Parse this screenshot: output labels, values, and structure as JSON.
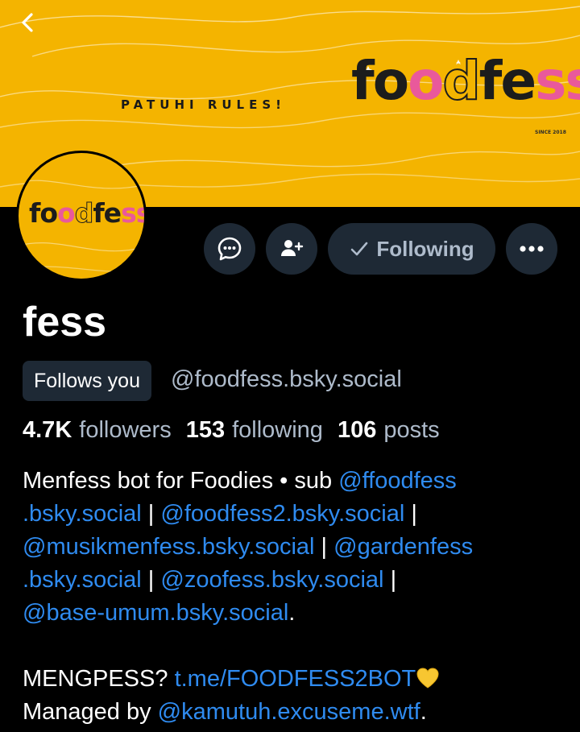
{
  "colors": {
    "background": "#000000",
    "banner": "#f4b400",
    "button_bg": "#1e2935",
    "muted_text": "#aebbcb",
    "link": "#2f8bf0",
    "logo_pink": "#e9599b"
  },
  "banner": {
    "slogan": "PATUHI RULES!",
    "logo_parts": [
      "fo",
      "o",
      "d",
      "fe",
      "ss"
    ],
    "since": "SINCE 2018"
  },
  "avatar": {
    "logo_parts": [
      "fo",
      "o",
      "d",
      "fe",
      "ss"
    ]
  },
  "icons": {
    "back": "chevron-left-icon",
    "message": "chat-bubble-icon",
    "add_user": "person-plus-icon",
    "check": "check-icon",
    "more": "ellipsis-icon",
    "heart": "yellow-heart-icon"
  },
  "actions": {
    "following_label": "Following"
  },
  "profile": {
    "display_name": "fess",
    "follows_badge": "Follows you",
    "handle": "@foodfess.bsky.social"
  },
  "stats": [
    {
      "value": "4.7K",
      "label": "followers"
    },
    {
      "value": "153",
      "label": "following"
    },
    {
      "value": "106",
      "label": "posts"
    }
  ],
  "bio": {
    "intro": "Menfess bot for Foodies • sub ",
    "link1a": "@ffoodfess",
    "link1b": ".bsky.social",
    "sep": " | ",
    "link2": "@foodfess2.bsky.social",
    "sep_end": " |",
    "link3": "@musikmenfess.bsky.social",
    "link4a": "@gardenfess",
    "link4b": ".bsky.social",
    "link5": "@zoofess.bsky.social",
    "link6": "@base-umum.bsky.social",
    "period": ".",
    "mengpess_label": "MENGPESS? ",
    "telegram_link": "t.me/FOODFESS2BOT",
    "managed_label": "Managed by ",
    "manager_link": "@kamutuh.excuseme.wtf",
    "managed_end": "."
  }
}
